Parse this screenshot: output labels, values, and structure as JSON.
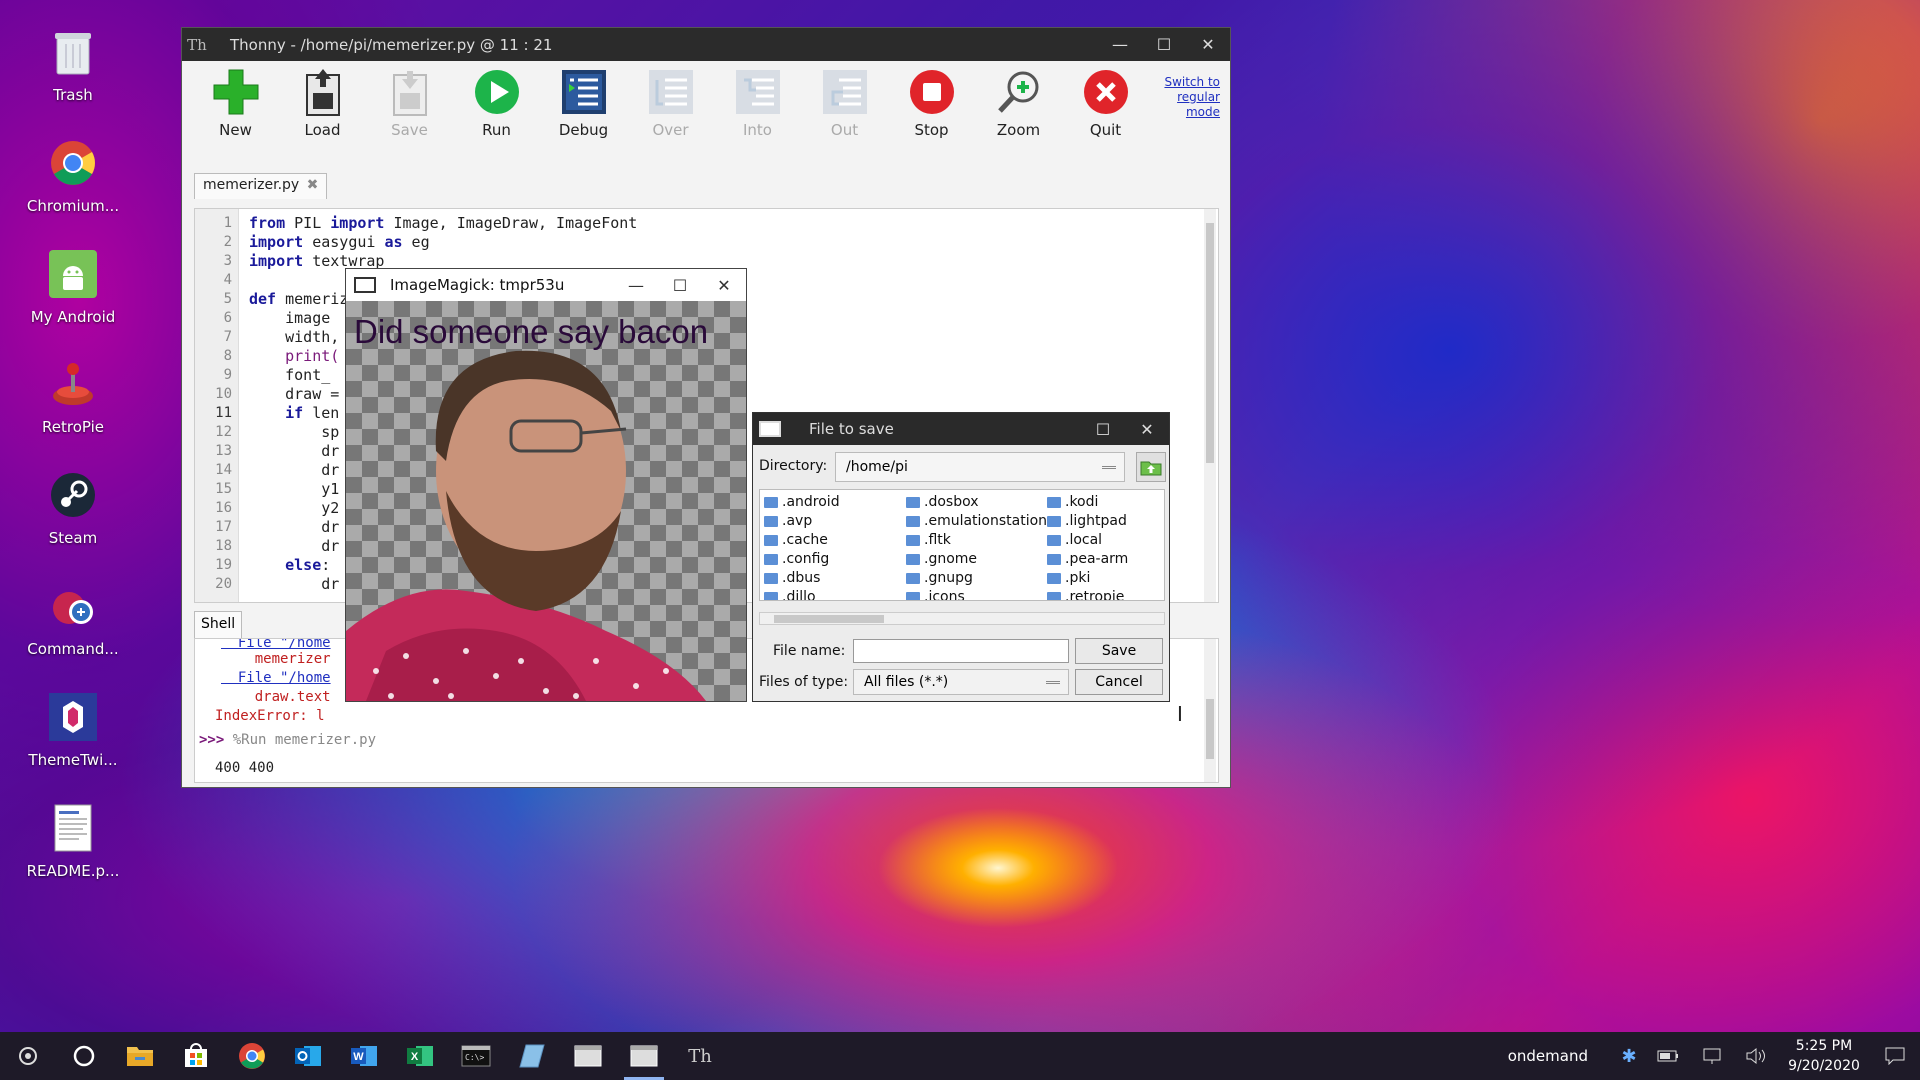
{
  "desktop": {
    "icons": [
      {
        "label": "Trash",
        "icon": "trash-icon"
      },
      {
        "label": "Chromium...",
        "icon": "chromium-icon"
      },
      {
        "label": "My Android",
        "icon": "android-icon"
      },
      {
        "label": "RetroPie",
        "icon": "retropie-icon"
      },
      {
        "label": "Steam",
        "icon": "steam-icon"
      },
      {
        "label": "Command...",
        "icon": "command-icon"
      },
      {
        "label": "ThemeTwi...",
        "icon": "themetwi-icon"
      },
      {
        "label": "README.p...",
        "icon": "readme-icon"
      }
    ]
  },
  "thonny": {
    "logo": "Th",
    "title": "Thonny  -  /home/pi/memerizer.py  @  11 : 21",
    "toolbar": {
      "new": "New",
      "load": "Load",
      "save": "Save",
      "run": "Run",
      "debug": "Debug",
      "over": "Over",
      "into": "Into",
      "out": "Out",
      "stop": "Stop",
      "zoom": "Zoom",
      "quit": "Quit"
    },
    "switch_mode": [
      "Switch to",
      "regular",
      "mode"
    ],
    "tab_label": "memerizer.py",
    "line_numbers": [
      "1",
      "2",
      "3",
      "4",
      "5",
      "6",
      "7",
      "8",
      "9",
      "10",
      "11",
      "12",
      "13",
      "14",
      "15",
      "16",
      "17",
      "18",
      "19",
      "20"
    ],
    "code": {
      "l1a": "from",
      "l1b": " PIL ",
      "l1c": "import",
      "l1d": " Image, ImageDraw, ImageFont",
      "l2a": "import",
      "l2b": " easygui ",
      "l2c": "as",
      "l2d": " eg",
      "l3a": "import",
      "l3b": " textwrap",
      "l5a": "def",
      "l5b": " memerizer(name, text, colour):",
      "l6": "    image",
      "l7": "    width,",
      "l8": "    print(",
      "l9": "    font_",
      "l10": "    draw =",
      "l11a": "    ",
      "l11b": "if",
      "l11c": " len",
      "l12": "        sp",
      "l13": "        dr",
      "l14": "        dr",
      "l15": "        y1",
      "l16": "        y2",
      "l17": "        dr",
      "l18": "        dr",
      "l19a": "    ",
      "l19b": "else",
      "l19c": ":",
      "l20": "        dr"
    },
    "shell_tab": "Shell",
    "shell": {
      "line1": "  File \"/home",
      "line2": "    memerizer",
      "line3": "  File \"/home",
      "line4": "    draw.text",
      "line5": "IndexError: l",
      "prompt": ">>>",
      "command": " %Run memerizer.py",
      "output": "400 400"
    }
  },
  "imagemagick": {
    "title": "ImageMagick: tmpr53u",
    "meme_text": "Did someone say bacon"
  },
  "file_dialog": {
    "title": "File to save",
    "directory_label": "Directory:",
    "directory_value": "/home/pi",
    "folders": [
      ".android",
      ".avp",
      ".cache",
      ".config",
      ".dbus",
      ".dillo",
      ".dosbox",
      ".emulationstation",
      ".fltk",
      ".gnome",
      ".gnupg",
      ".icons",
      ".kodi",
      ".lightpad",
      ".local",
      ".pea-arm",
      ".pki",
      ".retropie"
    ],
    "file_name_label": "File name:",
    "file_name_value": "",
    "file_type_label": "Files of type:",
    "file_type_value": "All files (*.*)",
    "save": "Save",
    "cancel": "Cancel"
  },
  "taskbar": {
    "apps": [
      "start-icon",
      "cortana-icon",
      "file-explorer-icon",
      "store-icon",
      "chrome-icon",
      "outlook-icon",
      "word-icon",
      "excel-icon",
      "terminal-icon",
      "remote-icon",
      "window-icon",
      "window-icon-active",
      "thonny-icon"
    ],
    "network_name": "ondemand",
    "time": "5:25 PM",
    "date": "9/20/2020"
  },
  "colors": {
    "run": "#1db44a",
    "stop": "#e0242a",
    "quit": "#e0242a",
    "new": "#2ab02a",
    "keyword": "#1a1a9a",
    "link": "#2030c0"
  }
}
